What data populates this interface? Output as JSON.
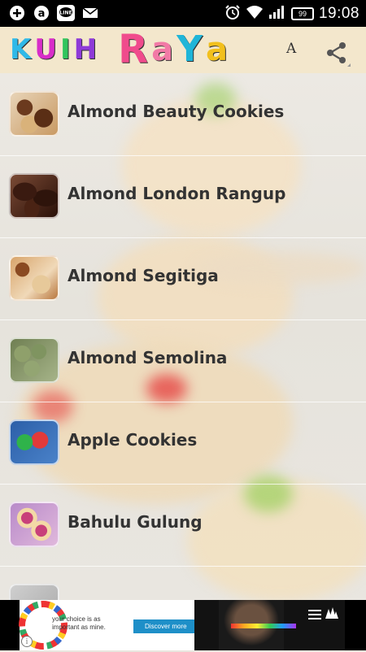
{
  "status_bar": {
    "time": "19:08",
    "battery": "99",
    "icons": [
      "add-circle-icon",
      "a-circle-icon",
      "line-app-icon",
      "mail-icon",
      "alarm-clock-icon",
      "wifi-icon",
      "signal-icon",
      "battery-icon"
    ]
  },
  "app_bar": {
    "title_letters": [
      "K",
      "U",
      "I",
      "H",
      " ",
      "R",
      "a",
      "Y",
      "a"
    ],
    "title_colors": [
      "#2fb9e8",
      "#d82dc9",
      "#31c55d",
      "#8e3ad8",
      "",
      "#f04b8c",
      "#f27aa6",
      "#1fb5d8",
      "#f2c01d"
    ],
    "font_size_icon": "A",
    "share_icon": "share-icon"
  },
  "recipes": [
    {
      "label": "Almond Beauty Cookies"
    },
    {
      "label": "Almond London Rangup"
    },
    {
      "label": "Almond Segitiga"
    },
    {
      "label": "Almond Semolina"
    },
    {
      "label": "Apple Cookies"
    },
    {
      "label": "Bahulu Gulung"
    },
    {
      "label": ""
    }
  ],
  "ad": {
    "tagline": "your choice is as important as mine.",
    "cta": "Discover more"
  }
}
